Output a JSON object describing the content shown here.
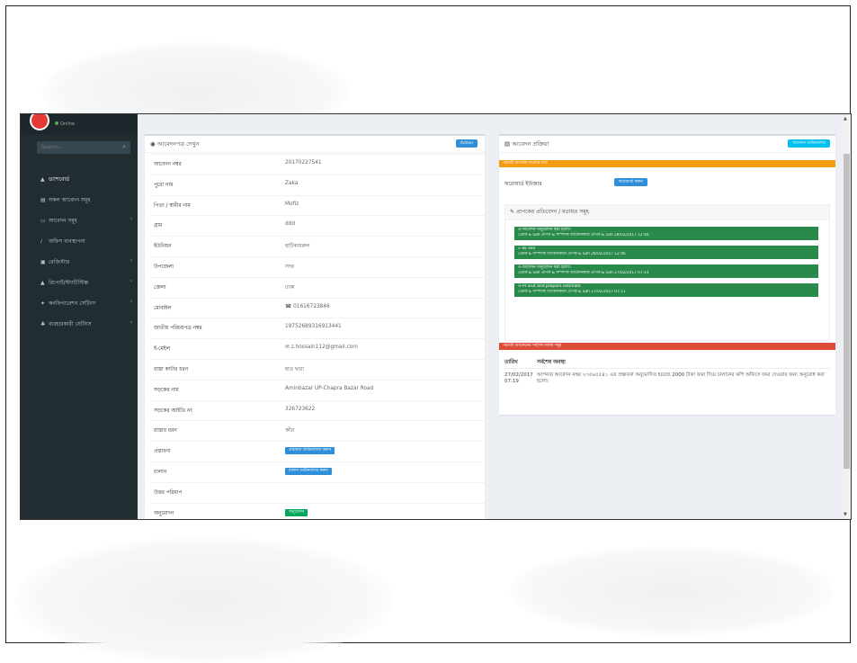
{
  "sidebar": {
    "online_label": "Online",
    "search_placeholder": "Search...",
    "menu_header": "",
    "items": [
      {
        "label": "ড্যাশবোর্ড",
        "icon": "dashboard-icon",
        "has_chevron": false
      },
      {
        "label": "সকল আবেদন সমূহ",
        "icon": "file-icon",
        "has_chevron": false
      },
      {
        "label": "আবেদন সমূহ",
        "icon": "folder-icon",
        "has_chevron": true
      },
      {
        "label": "অফিস ব্যবস্থাপনা",
        "icon": "edit-icon",
        "has_chevron": false
      },
      {
        "label": "রেজিস্টার",
        "icon": "book-icon",
        "has_chevron": true
      },
      {
        "label": "রিপোর্ট/স্ট্যাটিস্টিক্স",
        "icon": "chart-icon",
        "has_chevron": true
      },
      {
        "label": "কনফিগারেশন সেটিংস",
        "icon": "settings-icon",
        "has_chevron": true
      },
      {
        "label": "ব্যবহারকারী সেটিংস",
        "icon": "users-icon",
        "has_chevron": true
      }
    ]
  },
  "details": {
    "title": "আবেদনপত্র দেখুন",
    "action_button": "Action",
    "rows": [
      {
        "label": "আবেদন নম্বর",
        "value": "20170227541"
      },
      {
        "label": "পুরো নাম",
        "value": "Zaka"
      },
      {
        "label": "পিতা / স্বামীর নাম",
        "value": "Mofiz"
      },
      {
        "label": "গ্রাম",
        "value": "ddd"
      },
      {
        "label": "ইউনিয়ন",
        "value": "হাটিকামরুল"
      },
      {
        "label": "উপজেলা",
        "value": "সদর"
      },
      {
        "label": "জেলা",
        "value": "ঢাকা"
      },
      {
        "label": "মোবাইল",
        "value": "01616723846",
        "icon": "phone-icon"
      },
      {
        "label": "জাতীয় পরিচয়পত্র নম্বর",
        "value": "19752689316913441"
      },
      {
        "label": "ই-মেইল",
        "value": "z.hossain112@gmail.com",
        "icon": "email-icon"
      },
      {
        "label": "রাস্তা কাটার ধরন",
        "value": "হাত দ্বারা"
      },
      {
        "label": "সড়কের নাম",
        "value": "Aminbazar UP-Chapra Bazar Road"
      },
      {
        "label": "সড়কের আইডি নং",
        "value": "326723622"
      },
      {
        "label": "রাস্তার ধরন",
        "value": "কাঁচা"
      },
      {
        "label": "প্রস্তাবনা",
        "button": "প্রস্তাবনা ডাউনলোড করুন"
      },
      {
        "label": "চালান",
        "button": "চালান ডাউনলোড করুন"
      },
      {
        "label": "উত্তর পরিমাপ",
        "value": ""
      },
      {
        "label": "অনুমোদন",
        "button": "অনুমোদন"
      }
    ]
  },
  "process": {
    "title": "আবেদন প্রক্রিয়া",
    "header_button": "আবেদন ডাউনলোড",
    "orange_bar": "পরবর্তী আবেদন সংক্রান্ত তথ্য",
    "forward_label": "ফরোয়ার্ড ইউজার",
    "forward_button": "ফরোয়ার্ড করুন",
    "comments_title": "প্রাপকের প্রতিবেদন / মতামত সমূহ",
    "comments": [
      {
        "line1": "এ-আবেদন অনুমোদন করা হলো।",
        "line2": "প্রেরক & Safi প্রাপক & সম্পাদক আবেদনকারী প্রাপক & Safi 28/02/2017 12:46"
      },
      {
        "line1": "৫-ok see",
        "line2": "প্রেরক & সম্পাদক আবেদনকারী প্রাপক & Safi 28/02/2017 12:46"
      },
      {
        "line1": "এ-আবেদন অনুমোদন করা হলো।",
        "line2": "প্রেরক & Safi প্রাপক & সম্পাদক আবেদনকারী প্রাপক & Safi 27/02/2017 07:14"
      },
      {
        "line1": "এ-Pl visit and prepare estimate",
        "line2": "প্রেরক & সম্পাদক আবেদনকারী প্রাপক & Safi 27/02/2017 07:11"
      }
    ],
    "red_bar": "পরবর্তী আবেদনের সর্বশেষ অবস্থা সমূহ",
    "status_headers": [
      "তারিখ",
      "সর্বশেষ অবস্থা"
    ],
    "status_rows": [
      {
        "date": "27/02/2017 07:19",
        "text": "আপনার আবেদন নম্বর ২৩৫৬৫৫৪১ এর প্রস্তাবনা অনুমোদিত হয়েছে 2000 টাকা জমা দিয়ে চালানের কপি অফিসে জমা দেওয়ার জন্য অনুরোধ করা হলো।"
      }
    ]
  },
  "colors": {
    "sidebar": "#222d32",
    "content_bg": "#ecf0f5",
    "orange": "#f39c12",
    "red": "#dd4b39",
    "green_comment": "#2a8a4c",
    "blue_button": "#2f8fd8"
  }
}
